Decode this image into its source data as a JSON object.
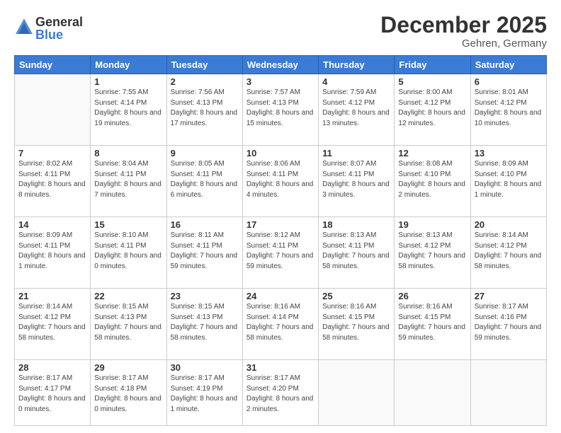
{
  "logo": {
    "general": "General",
    "blue": "Blue"
  },
  "header": {
    "month": "December 2025",
    "location": "Gehren, Germany"
  },
  "weekdays": [
    "Sunday",
    "Monday",
    "Tuesday",
    "Wednesday",
    "Thursday",
    "Friday",
    "Saturday"
  ],
  "weeks": [
    [
      {
        "day": "",
        "sunrise": "",
        "sunset": "",
        "daylight": ""
      },
      {
        "day": "1",
        "sunrise": "Sunrise: 7:55 AM",
        "sunset": "Sunset: 4:14 PM",
        "daylight": "Daylight: 8 hours and 19 minutes."
      },
      {
        "day": "2",
        "sunrise": "Sunrise: 7:56 AM",
        "sunset": "Sunset: 4:13 PM",
        "daylight": "Daylight: 8 hours and 17 minutes."
      },
      {
        "day": "3",
        "sunrise": "Sunrise: 7:57 AM",
        "sunset": "Sunset: 4:13 PM",
        "daylight": "Daylight: 8 hours and 15 minutes."
      },
      {
        "day": "4",
        "sunrise": "Sunrise: 7:59 AM",
        "sunset": "Sunset: 4:12 PM",
        "daylight": "Daylight: 8 hours and 13 minutes."
      },
      {
        "day": "5",
        "sunrise": "Sunrise: 8:00 AM",
        "sunset": "Sunset: 4:12 PM",
        "daylight": "Daylight: 8 hours and 12 minutes."
      },
      {
        "day": "6",
        "sunrise": "Sunrise: 8:01 AM",
        "sunset": "Sunset: 4:12 PM",
        "daylight": "Daylight: 8 hours and 10 minutes."
      }
    ],
    [
      {
        "day": "7",
        "sunrise": "Sunrise: 8:02 AM",
        "sunset": "Sunset: 4:11 PM",
        "daylight": "Daylight: 8 hours and 8 minutes."
      },
      {
        "day": "8",
        "sunrise": "Sunrise: 8:04 AM",
        "sunset": "Sunset: 4:11 PM",
        "daylight": "Daylight: 8 hours and 7 minutes."
      },
      {
        "day": "9",
        "sunrise": "Sunrise: 8:05 AM",
        "sunset": "Sunset: 4:11 PM",
        "daylight": "Daylight: 8 hours and 6 minutes."
      },
      {
        "day": "10",
        "sunrise": "Sunrise: 8:06 AM",
        "sunset": "Sunset: 4:11 PM",
        "daylight": "Daylight: 8 hours and 4 minutes."
      },
      {
        "day": "11",
        "sunrise": "Sunrise: 8:07 AM",
        "sunset": "Sunset: 4:11 PM",
        "daylight": "Daylight: 8 hours and 3 minutes."
      },
      {
        "day": "12",
        "sunrise": "Sunrise: 8:08 AM",
        "sunset": "Sunset: 4:10 PM",
        "daylight": "Daylight: 8 hours and 2 minutes."
      },
      {
        "day": "13",
        "sunrise": "Sunrise: 8:09 AM",
        "sunset": "Sunset: 4:10 PM",
        "daylight": "Daylight: 8 hours and 1 minute."
      }
    ],
    [
      {
        "day": "14",
        "sunrise": "Sunrise: 8:09 AM",
        "sunset": "Sunset: 4:11 PM",
        "daylight": "Daylight: 8 hours and 1 minute."
      },
      {
        "day": "15",
        "sunrise": "Sunrise: 8:10 AM",
        "sunset": "Sunset: 4:11 PM",
        "daylight": "Daylight: 8 hours and 0 minutes."
      },
      {
        "day": "16",
        "sunrise": "Sunrise: 8:11 AM",
        "sunset": "Sunset: 4:11 PM",
        "daylight": "Daylight: 7 hours and 59 minutes."
      },
      {
        "day": "17",
        "sunrise": "Sunrise: 8:12 AM",
        "sunset": "Sunset: 4:11 PM",
        "daylight": "Daylight: 7 hours and 59 minutes."
      },
      {
        "day": "18",
        "sunrise": "Sunrise: 8:13 AM",
        "sunset": "Sunset: 4:11 PM",
        "daylight": "Daylight: 7 hours and 58 minutes."
      },
      {
        "day": "19",
        "sunrise": "Sunrise: 8:13 AM",
        "sunset": "Sunset: 4:12 PM",
        "daylight": "Daylight: 7 hours and 58 minutes."
      },
      {
        "day": "20",
        "sunrise": "Sunrise: 8:14 AM",
        "sunset": "Sunset: 4:12 PM",
        "daylight": "Daylight: 7 hours and 58 minutes."
      }
    ],
    [
      {
        "day": "21",
        "sunrise": "Sunrise: 8:14 AM",
        "sunset": "Sunset: 4:12 PM",
        "daylight": "Daylight: 7 hours and 58 minutes."
      },
      {
        "day": "22",
        "sunrise": "Sunrise: 8:15 AM",
        "sunset": "Sunset: 4:13 PM",
        "daylight": "Daylight: 7 hours and 58 minutes."
      },
      {
        "day": "23",
        "sunrise": "Sunrise: 8:15 AM",
        "sunset": "Sunset: 4:13 PM",
        "daylight": "Daylight: 7 hours and 58 minutes."
      },
      {
        "day": "24",
        "sunrise": "Sunrise: 8:16 AM",
        "sunset": "Sunset: 4:14 PM",
        "daylight": "Daylight: 7 hours and 58 minutes."
      },
      {
        "day": "25",
        "sunrise": "Sunrise: 8:16 AM",
        "sunset": "Sunset: 4:15 PM",
        "daylight": "Daylight: 7 hours and 58 minutes."
      },
      {
        "day": "26",
        "sunrise": "Sunrise: 8:16 AM",
        "sunset": "Sunset: 4:15 PM",
        "daylight": "Daylight: 7 hours and 59 minutes."
      },
      {
        "day": "27",
        "sunrise": "Sunrise: 8:17 AM",
        "sunset": "Sunset: 4:16 PM",
        "daylight": "Daylight: 7 hours and 59 minutes."
      }
    ],
    [
      {
        "day": "28",
        "sunrise": "Sunrise: 8:17 AM",
        "sunset": "Sunset: 4:17 PM",
        "daylight": "Daylight: 8 hours and 0 minutes."
      },
      {
        "day": "29",
        "sunrise": "Sunrise: 8:17 AM",
        "sunset": "Sunset: 4:18 PM",
        "daylight": "Daylight: 8 hours and 0 minutes."
      },
      {
        "day": "30",
        "sunrise": "Sunrise: 8:17 AM",
        "sunset": "Sunset: 4:19 PM",
        "daylight": "Daylight: 8 hours and 1 minute."
      },
      {
        "day": "31",
        "sunrise": "Sunrise: 8:17 AM",
        "sunset": "Sunset: 4:20 PM",
        "daylight": "Daylight: 8 hours and 2 minutes."
      },
      {
        "day": "",
        "sunrise": "",
        "sunset": "",
        "daylight": ""
      },
      {
        "day": "",
        "sunrise": "",
        "sunset": "",
        "daylight": ""
      },
      {
        "day": "",
        "sunrise": "",
        "sunset": "",
        "daylight": ""
      }
    ]
  ]
}
